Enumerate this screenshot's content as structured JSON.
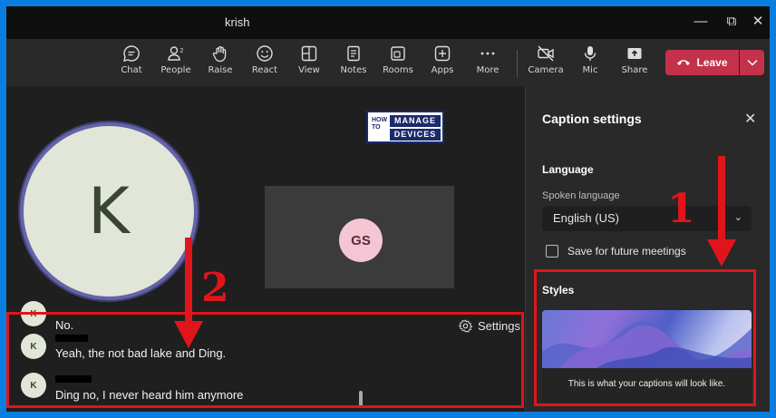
{
  "window": {
    "title": "krish"
  },
  "toolbar": {
    "items": [
      {
        "label": "Chat",
        "icon": "chat-icon"
      },
      {
        "label": "People",
        "icon": "people-icon",
        "badge": "2"
      },
      {
        "label": "Raise",
        "icon": "hand-icon"
      },
      {
        "label": "React",
        "icon": "smile-icon"
      },
      {
        "label": "View",
        "icon": "view-icon"
      },
      {
        "label": "Notes",
        "icon": "notes-icon"
      },
      {
        "label": "Rooms",
        "icon": "rooms-icon"
      },
      {
        "label": "Apps",
        "icon": "apps-icon"
      },
      {
        "label": "More",
        "icon": "more-icon"
      },
      {
        "label": "Camera",
        "icon": "camera-off-icon"
      },
      {
        "label": "Mic",
        "icon": "mic-icon"
      },
      {
        "label": "Share",
        "icon": "share-icon"
      }
    ],
    "leave_label": "Leave"
  },
  "stage": {
    "main_participant_initial": "K",
    "logo": {
      "how": "HOW",
      "to": "TO",
      "manage": "MANAGE",
      "devices": "DEVICES"
    },
    "tile_initials": "GS"
  },
  "captions": {
    "settings_label": "Settings",
    "lines": [
      {
        "initial": "K",
        "text": "No."
      },
      {
        "initial": "K",
        "text": "Yeah, the not bad lake and Ding."
      },
      {
        "initial": "K",
        "text": "Ding no, I never heard him anymore"
      }
    ]
  },
  "panel": {
    "title": "Caption settings",
    "language_heading": "Language",
    "spoken_language_label": "Spoken language",
    "spoken_language_value": "English (US)",
    "save_label": "Save for future meetings",
    "styles_heading": "Styles",
    "preview_text": "This is what your captions will look like."
  },
  "annotations": {
    "one": "1",
    "two": "2"
  },
  "colors": {
    "accent": "#6264a7",
    "leave": "#c4314b",
    "annotation": "#e0151b",
    "frame": "#0a7ee0"
  }
}
